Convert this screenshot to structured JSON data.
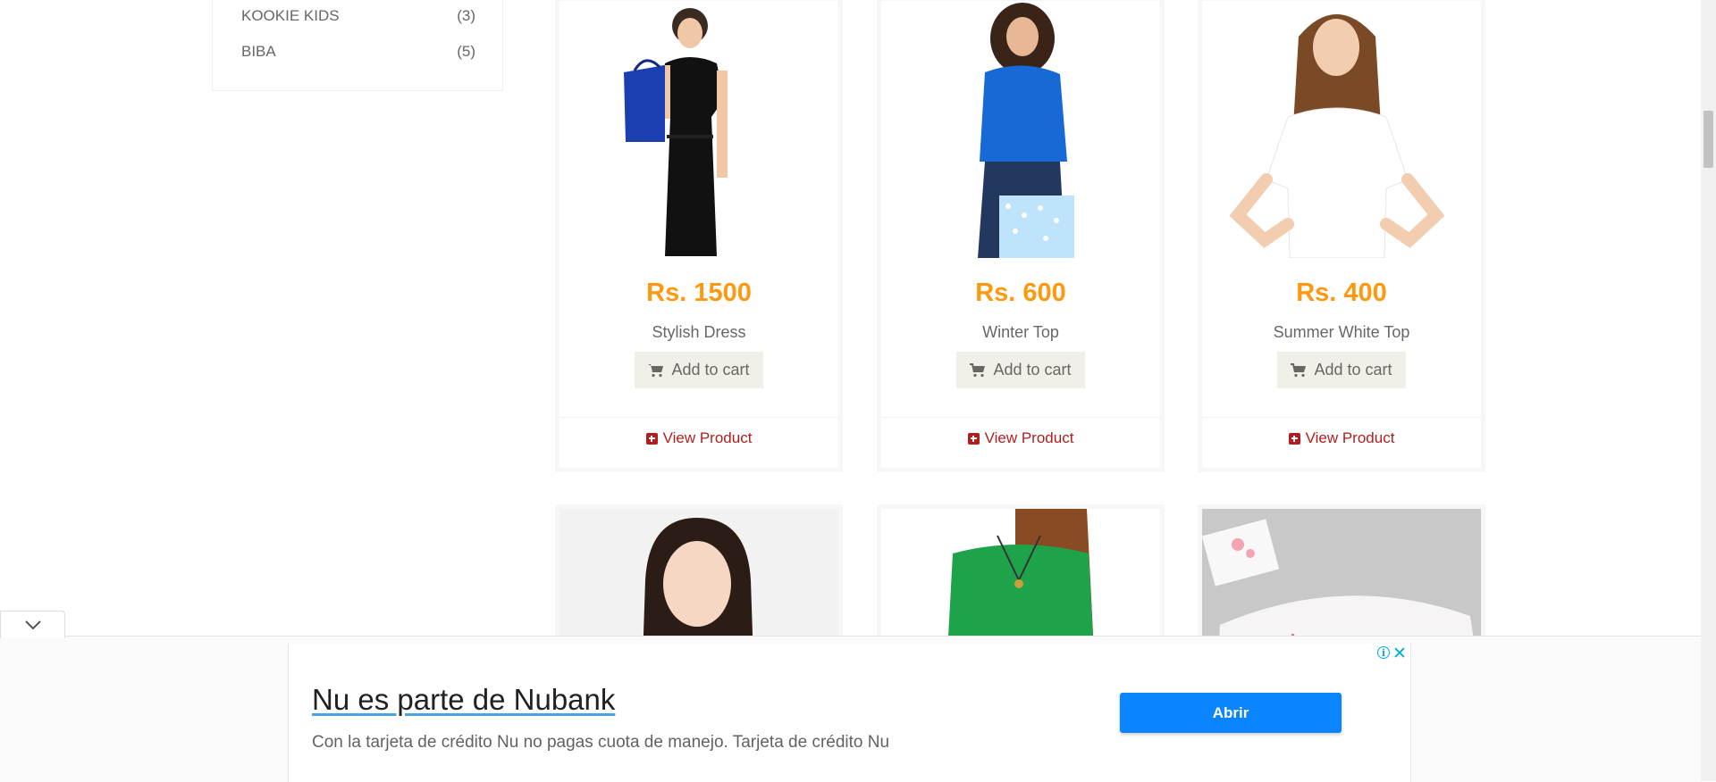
{
  "brands": [
    {
      "name": "KOOKIE KIDS",
      "count": "(3)"
    },
    {
      "name": "BIBA",
      "count": "(5)"
    }
  ],
  "products": [
    {
      "price": "Rs. 1500",
      "name": "Stylish Dress",
      "cart_label": "Add to cart",
      "view_label": "View Product"
    },
    {
      "price": "Rs. 600",
      "name": "Winter Top",
      "cart_label": "Add to cart",
      "view_label": "View Product"
    },
    {
      "price": "Rs. 400",
      "name": "Summer White Top",
      "cart_label": "Add to cart",
      "view_label": "View Product"
    }
  ],
  "colors": {
    "price": "#FE980F",
    "link": "#b21e1e",
    "ad_button": "#0a84ff"
  },
  "ad": {
    "title": "Nu es parte de Nubank",
    "description": "Con la tarjeta de crédito Nu no pagas cuota de manejo. Tarjeta de crédito Nu",
    "button_label": "Abrir",
    "info_icon": "info-icon",
    "close_icon": "close-icon"
  }
}
